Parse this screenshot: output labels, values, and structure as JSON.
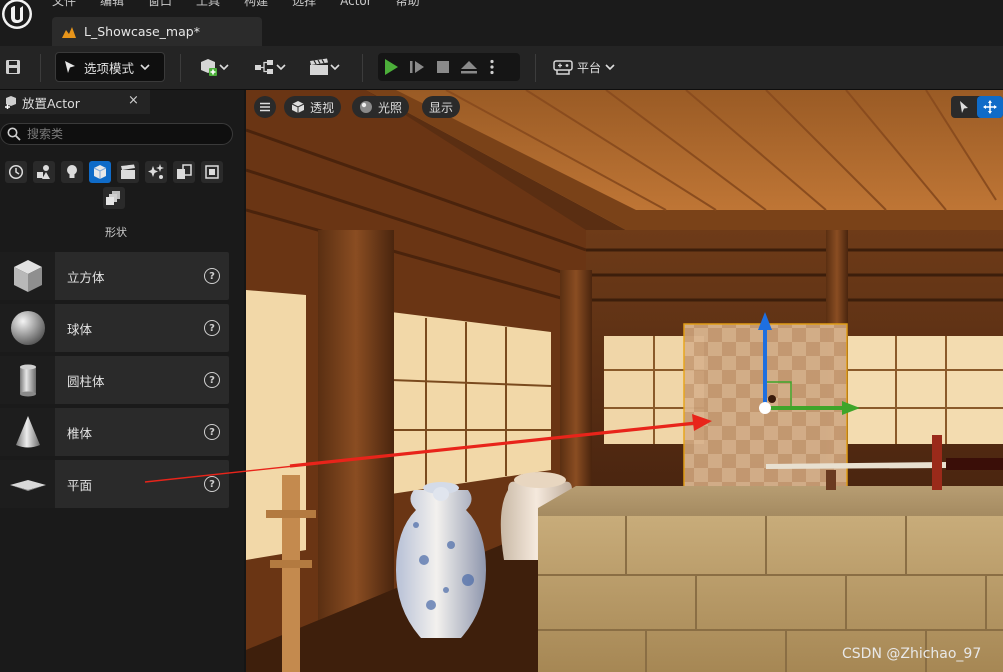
{
  "menu": {
    "items": [
      "文件",
      "编辑",
      "窗口",
      "工具",
      "构建",
      "选择",
      "Actor",
      "帮助"
    ]
  },
  "map_tab": {
    "label": "L_Showcase_map*"
  },
  "toolbar": {
    "mode_label": "选项模式",
    "platform_label": "平台"
  },
  "panel": {
    "title": "放置Actor",
    "close": "×",
    "search_placeholder": "搜索类",
    "category_label": "形状",
    "categories": [
      "recent-icon",
      "basic-icon",
      "lights-icon",
      "shapes-icon",
      "cinematic-icon",
      "visual-effects-icon",
      "volumes-icon",
      "all-classes-icon",
      "extra-icon"
    ],
    "shapes": [
      {
        "label": "立方体",
        "help": "?"
      },
      {
        "label": "球体",
        "help": "?"
      },
      {
        "label": "圆柱体",
        "help": "?"
      },
      {
        "label": "椎体",
        "help": "?"
      },
      {
        "label": "平面",
        "help": "?"
      }
    ]
  },
  "viewport": {
    "perspective_label": "透视",
    "lighting_label": "光照",
    "show_label": "显示",
    "watermark": "CSDN @Zhichao_97"
  },
  "colors": {
    "accent_blue": "#0f6bc8",
    "play_green": "#4caf3a",
    "arrow_red": "#e8241a",
    "gizmo_orange": "#e8a317"
  }
}
